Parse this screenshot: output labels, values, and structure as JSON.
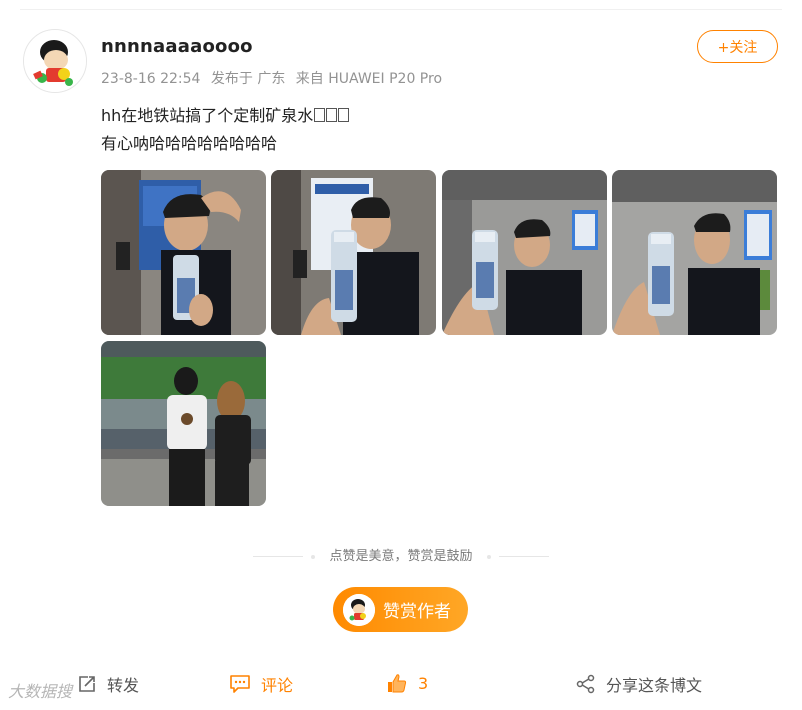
{
  "post": {
    "username": "nnnnaaaaoooo",
    "date": "23-8-16 22:54",
    "location": "发布于 广东",
    "source": "来自 HUAWEI P20 Pro",
    "follow_label": "+关注",
    "text_line1": "hh在地铁站搞了个定制矿泉水",
    "text_line2": "有心呐哈哈哈哈哈哈哈哈"
  },
  "reward": {
    "hint": "点赞是美意，赞赏是鼓励",
    "button_label": "赞赏作者"
  },
  "actions": {
    "repost_label": "转发",
    "comment_label": "评论",
    "like_count": "3",
    "share_label": "分享这条博文"
  },
  "watermark": "大数据搜",
  "colors": {
    "accent": "#ff8200",
    "muted": "#939393"
  },
  "icons": [
    "avatar",
    "plus-icon",
    "repost-icon",
    "comment-icon",
    "thumb-up-icon",
    "share-icon"
  ]
}
